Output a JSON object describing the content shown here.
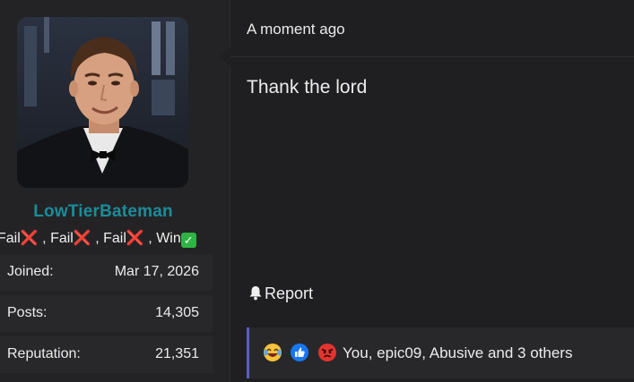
{
  "user": {
    "username": "LowTierBateman",
    "title_parts": [
      "Fail",
      "Fail",
      "Fail",
      "Win"
    ],
    "separator": ",",
    "username_color": "#1c8c9a",
    "stats": [
      {
        "label": "Joined:",
        "value": "Mar 17, 2026"
      },
      {
        "label": "Posts:",
        "value": "14,305"
      },
      {
        "label": "Reputation:",
        "value": "21,351"
      }
    ]
  },
  "message": {
    "timestamp": "A moment ago",
    "body": "Thank the lord",
    "report_label": "Report",
    "reactions": {
      "icons": [
        "laughing-crying-emoji",
        "thumbs-up-emoji",
        "angry-emoji"
      ],
      "summary": "You, epic09, Abusive and 3 others"
    }
  },
  "colors": {
    "accent_bar": "#5b5fc7",
    "fail": "#e0323c",
    "win": "#2fb344"
  }
}
